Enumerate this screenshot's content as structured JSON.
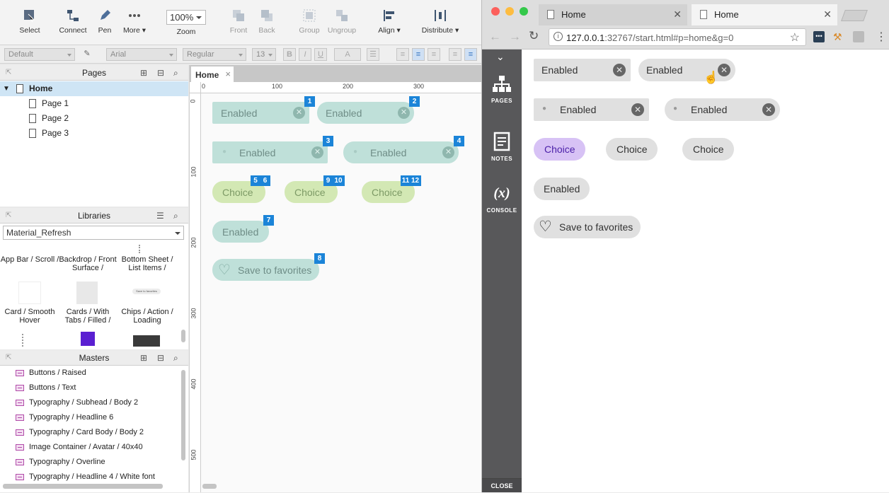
{
  "toolbar": {
    "select": "Select",
    "connect": "Connect",
    "pen": "Pen",
    "more": "More ▾",
    "zoom_value": "100%",
    "zoom_label": "Zoom",
    "front": "Front",
    "back": "Back",
    "group": "Group",
    "ungroup": "Ungroup",
    "align": "Align ▾",
    "distribute": "Distribute ▾"
  },
  "format": {
    "style": "Default",
    "font": "Arial",
    "weight": "Regular",
    "size": "13",
    "bold": "B",
    "italic": "I",
    "underline": "U",
    "color": "A"
  },
  "pages": {
    "title": "Pages",
    "items": [
      "Home",
      "Page 1",
      "Page 2",
      "Page 3"
    ]
  },
  "libraries": {
    "title": "Libraries",
    "selected": "Material_Refresh",
    "items": [
      "App Bar / Scroll /",
      "Backdrop / Front Surface /",
      "Bottom Sheet / List Items /",
      "Card / Smooth Hover",
      "Cards / With Tabs / Filled /",
      "Chips / Action / Loading"
    ],
    "thumb_text": "Save to favorites"
  },
  "masters": {
    "title": "Masters",
    "items": [
      "Buttons / Raised",
      "Buttons / Text",
      "Typography / Subhead / Body 2",
      "Typography / Headline 6",
      "Typography / Card Body / Body 2",
      "Image Container / Avatar / 40x40",
      "Typography / Overline",
      "Typography / Headline 4 / White font"
    ]
  },
  "canvas": {
    "tab": "Home",
    "ruler_h": [
      "0",
      "100",
      "200",
      "300"
    ],
    "ruler_v": [
      "0",
      "100",
      "200",
      "300",
      "400",
      "500"
    ],
    "chips": {
      "enabled": "Enabled",
      "choice": "Choice",
      "favorites": "Save to favorites"
    },
    "badges": [
      "1",
      "2",
      "3",
      "4",
      "5",
      "6",
      "9",
      "10",
      "11",
      "12",
      "7",
      "8"
    ]
  },
  "browser": {
    "tab1": "Home",
    "tab2": "Home",
    "url_host": "127.0.0.1",
    "url_rest": ":32767/start.html#p=home&g=0",
    "sidebar": {
      "pages": "PAGES",
      "notes": "NOTES",
      "console": "CONSOLE",
      "console_glyph": "(x)",
      "close": "CLOSE"
    },
    "chips": {
      "enabled": "Enabled",
      "choice": "Choice",
      "favorites": "Save to favorites"
    }
  },
  "colors": {
    "badge": "#1b84d8",
    "selected_choice": "#d7c2f5",
    "sidebar": "#58585a"
  }
}
